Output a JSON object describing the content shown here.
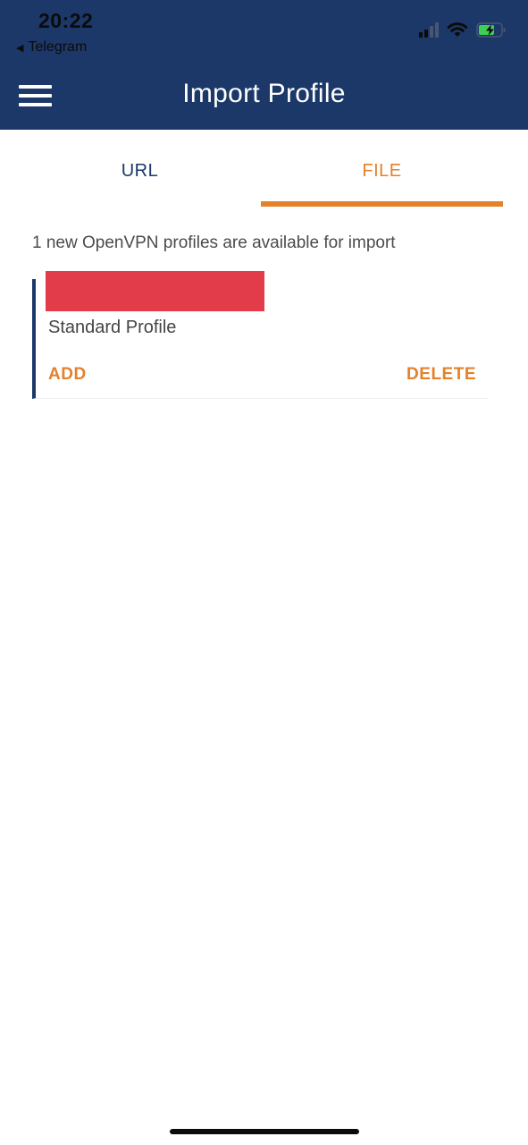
{
  "status_bar": {
    "time": "20:22",
    "back_app": "Telegram",
    "icons": [
      "cellular-signal-icon",
      "wifi-icon",
      "battery-charging-icon"
    ]
  },
  "header": {
    "title": "Import Profile",
    "menu_icon": "hamburger-menu-icon",
    "background": "#1b3869"
  },
  "tabs": [
    {
      "label": "URL",
      "active": false
    },
    {
      "label": "FILE",
      "active": true
    }
  ],
  "accent_color": "#e5802b",
  "content": {
    "available_message": "1 new OpenVPN profiles are available for import",
    "profiles": [
      {
        "type": "Standard Profile",
        "add_label": "ADD",
        "delete_label": "DELETE"
      }
    ]
  }
}
